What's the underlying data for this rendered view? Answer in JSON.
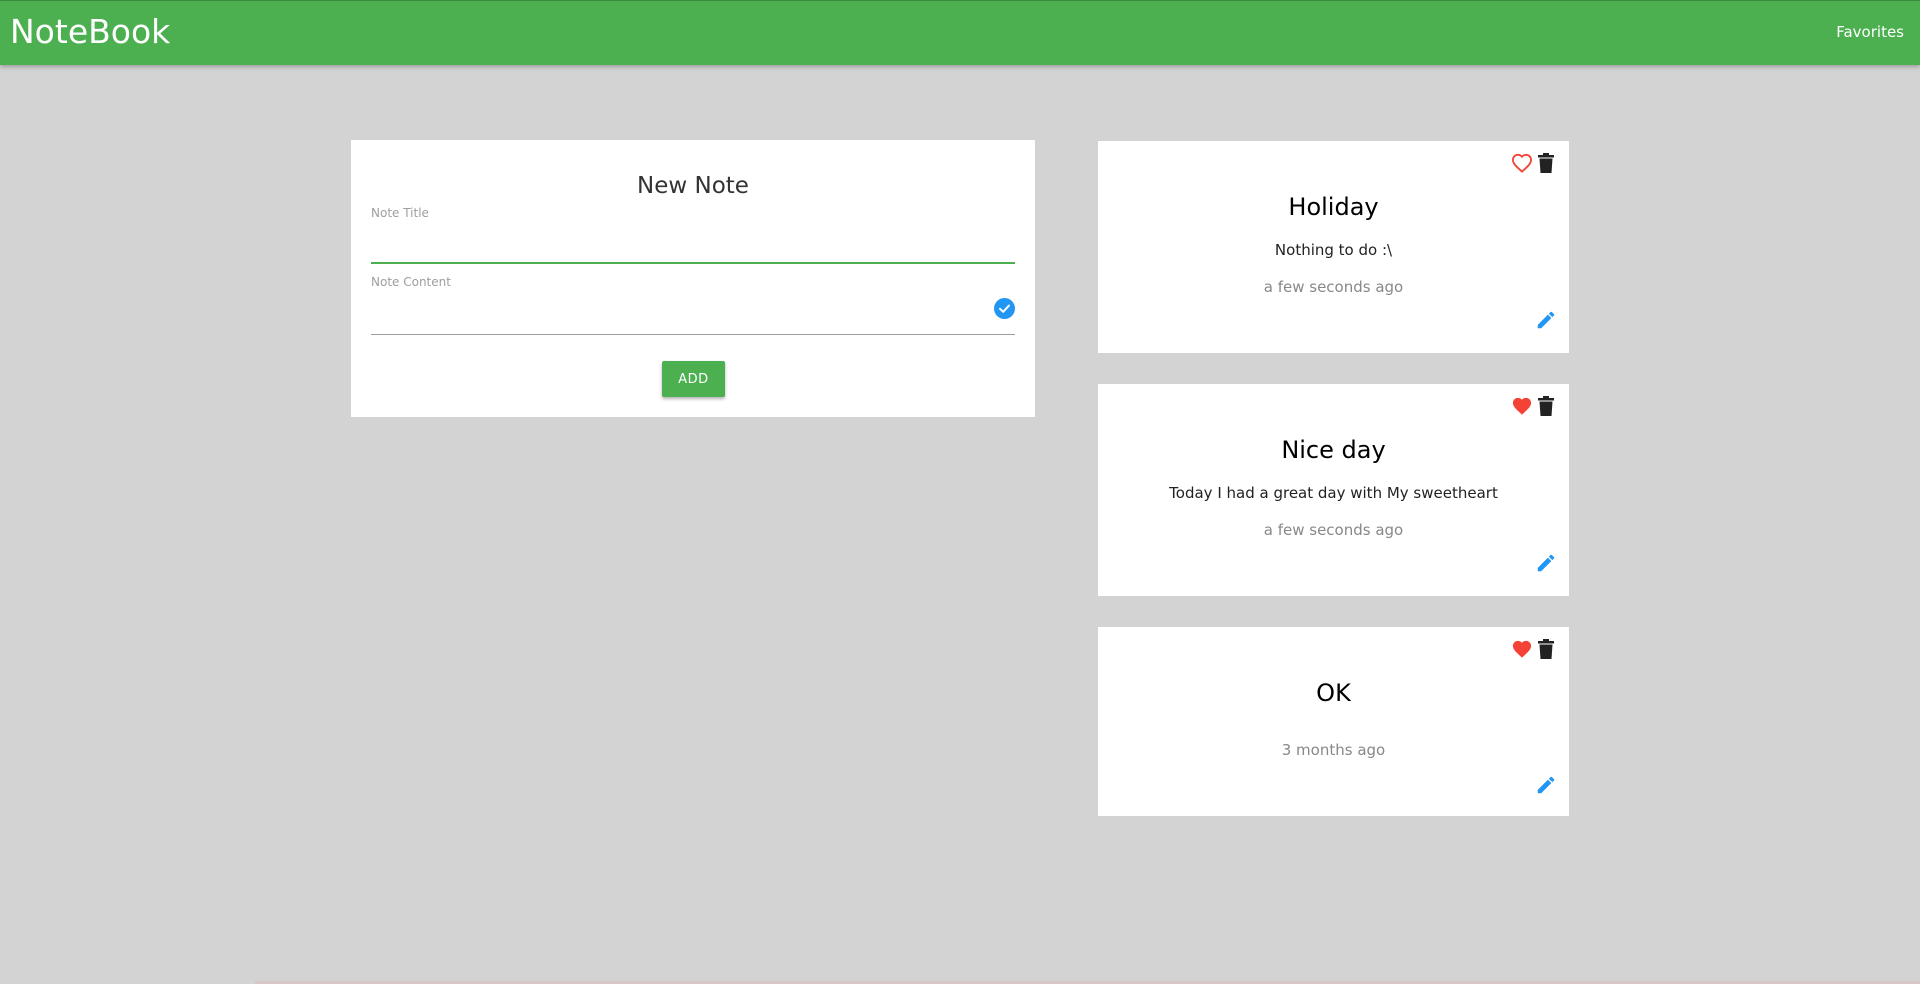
{
  "app": {
    "brand": "NoteBook",
    "nav_favorites": "Favorites"
  },
  "colors": {
    "primary": "#4caf50",
    "background": "#d3d3d3",
    "favorite": "#f44336",
    "edit": "#2196f3",
    "check": "#2196f3"
  },
  "form": {
    "heading": "New Note",
    "title_label": "Note Title",
    "title_value": "",
    "content_label": "Note Content",
    "content_value": "",
    "add_label": "ADD"
  },
  "notes": [
    {
      "title": "Holiday",
      "content": "Nothing to do :\\",
      "time": "a few seconds ago",
      "favorite": false,
      "favorite_icon": "heart-outline-icon",
      "delete_icon": "trash-icon",
      "edit_icon": "pencil-icon"
    },
    {
      "title": "Nice day",
      "content": "Today I had a great day with My sweetheart",
      "time": "a few seconds ago",
      "favorite": true,
      "favorite_icon": "heart-filled-icon",
      "delete_icon": "trash-icon",
      "edit_icon": "pencil-icon"
    },
    {
      "title": "OK",
      "content": "",
      "time": "3 months ago",
      "favorite": true,
      "favorite_icon": "heart-filled-icon",
      "delete_icon": "trash-icon",
      "edit_icon": "pencil-icon"
    }
  ]
}
